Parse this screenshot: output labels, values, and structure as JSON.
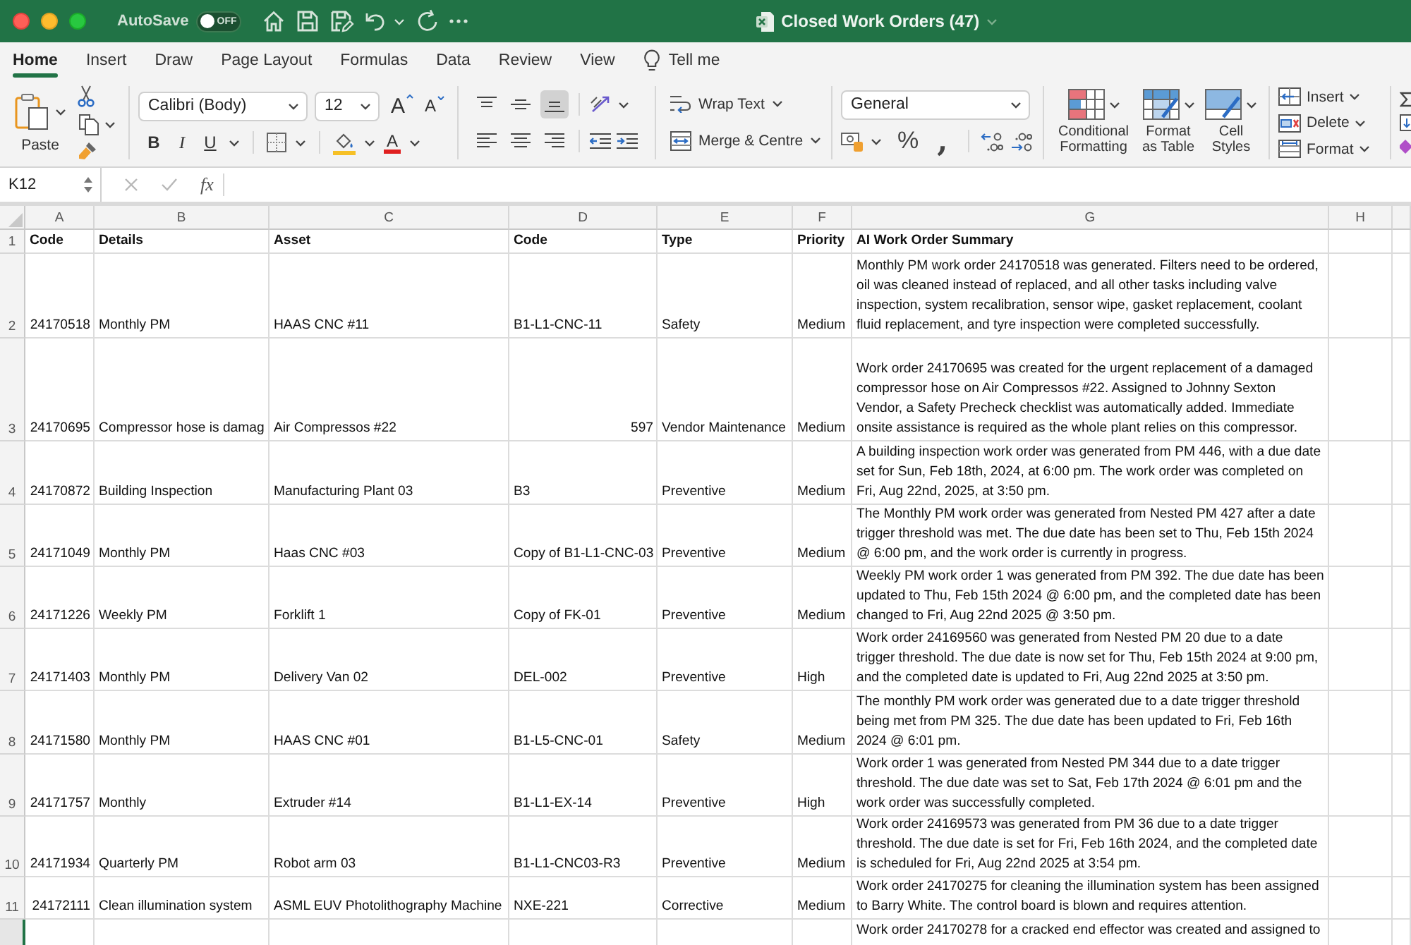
{
  "title_bar": {
    "autosave": {
      "label": "AutoSave",
      "state_text": "OFF",
      "on": false
    },
    "title": "Closed Work Orders (47)"
  },
  "ribbon_tabs": [
    {
      "label": "Home",
      "selected": true
    },
    {
      "label": "Insert",
      "selected": false
    },
    {
      "label": "Draw",
      "selected": false
    },
    {
      "label": "Page Layout",
      "selected": false
    },
    {
      "label": "Formulas",
      "selected": false
    },
    {
      "label": "Data",
      "selected": false
    },
    {
      "label": "Review",
      "selected": false
    },
    {
      "label": "View",
      "selected": false
    }
  ],
  "tell_me": "Tell me",
  "ribbon": {
    "paste": "Paste",
    "font_name": "Calibri (Body)",
    "font_size": "12",
    "grow_font": "A",
    "shrink_font": "A",
    "bold": "B",
    "italic": "I",
    "underline": "U",
    "font_color": "A",
    "vertical_align": [
      {
        "kind": "top",
        "selected": false
      },
      {
        "kind": "middle",
        "selected": false
      },
      {
        "kind": "bottom",
        "selected": true
      }
    ],
    "horizontal_align": [
      {
        "kind": "left",
        "selected": false
      },
      {
        "kind": "center",
        "selected": false
      },
      {
        "kind": "right",
        "selected": false
      }
    ],
    "wrap_text": "Wrap Text",
    "merge_centre": "Merge & Centre",
    "number_format": "General",
    "percent": "%",
    "comma": ",",
    "conditional_formatting": "Conditional Formatting",
    "format_as_table": "Format as Table",
    "cell_styles": "Cell Styles",
    "cells_buttons": [
      {
        "kind": "insert",
        "label": "Insert"
      },
      {
        "kind": "delete",
        "label": "Delete"
      },
      {
        "kind": "format",
        "label": "Format"
      }
    ]
  },
  "formula_bar": {
    "name_box": "K12",
    "function_label": "fx"
  },
  "columns": [
    "A",
    "B",
    "C",
    "D",
    "E",
    "F",
    "G",
    "H"
  ],
  "rows": [
    {
      "number": "1",
      "selected": false,
      "cells": [
        {
          "text": "Code",
          "kind": "heading"
        },
        {
          "text": "Details",
          "kind": "heading"
        },
        {
          "text": "Asset",
          "kind": "heading"
        },
        {
          "text": "Code",
          "kind": "heading"
        },
        {
          "text": "Type",
          "kind": "heading"
        },
        {
          "text": "Priority",
          "kind": "heading"
        },
        {
          "text": "AI Work Order Summary",
          "kind": "heading"
        }
      ]
    },
    {
      "number": "2",
      "selected": false,
      "cells": [
        {
          "text": "24170518",
          "kind": "number"
        },
        {
          "text": "Monthly PM",
          "kind": "text"
        },
        {
          "text": "HAAS CNC #11",
          "kind": "text"
        },
        {
          "text": "B1-L1-CNC-11",
          "kind": "text"
        },
        {
          "text": "Safety",
          "kind": "text"
        },
        {
          "text": "Medium",
          "kind": "text"
        },
        {
          "text": "Monthly PM work order 24170518 was generated. Filters need to be ordered, oil was cleaned instead of replaced, and all other tasks including valve inspection, system recalibration, sensor wipe, gasket replacement, coolant fluid replacement, and tyre inspection were completed successfully.",
          "kind": "text"
        }
      ]
    },
    {
      "number": "3",
      "selected": false,
      "cells": [
        {
          "text": "24170695",
          "kind": "number"
        },
        {
          "text": "Compressor hose is damag",
          "kind": "text"
        },
        {
          "text": "Air Compressos #22",
          "kind": "text"
        },
        {
          "text": "597",
          "kind": "number"
        },
        {
          "text": "Vendor Maintenance",
          "kind": "text"
        },
        {
          "text": "Medium",
          "kind": "text"
        },
        {
          "text": "Work order 24170695 was created for the urgent replacement of a damaged compressor hose on Air Compressos #22. Assigned to Johnny Sexton Vendor, a Safety Precheck checklist was automatically added. Immediate onsite assistance is required as the whole plant relies on this compressor.",
          "kind": "text"
        }
      ]
    },
    {
      "number": "4",
      "selected": false,
      "cells": [
        {
          "text": "24170872",
          "kind": "number"
        },
        {
          "text": "Building Inspection",
          "kind": "text"
        },
        {
          "text": "Manufacturing Plant 03",
          "kind": "text"
        },
        {
          "text": "B3",
          "kind": "text"
        },
        {
          "text": "Preventive",
          "kind": "text"
        },
        {
          "text": "Medium",
          "kind": "text"
        },
        {
          "text": "A building inspection work order was generated from PM 446, with a due date set for Sun, Feb 18th, 2024, at 6:00 pm. The work order was completed on Fri, Aug 22nd, 2025, at 3:50 pm.",
          "kind": "text"
        }
      ]
    },
    {
      "number": "5",
      "selected": false,
      "cells": [
        {
          "text": "24171049",
          "kind": "number"
        },
        {
          "text": "Monthly PM",
          "kind": "text"
        },
        {
          "text": "Haas CNC #03",
          "kind": "text"
        },
        {
          "text": "Copy of B1-L1-CNC-03",
          "kind": "text"
        },
        {
          "text": "Preventive",
          "kind": "text"
        },
        {
          "text": "Medium",
          "kind": "text"
        },
        {
          "text": "The Monthly PM work order was generated from Nested PM 427 after a date trigger threshold was met. The due date has been set to Thu, Feb 15th 2024 @ 6:00 pm, and the work order is currently in progress.",
          "kind": "text"
        }
      ]
    },
    {
      "number": "6",
      "selected": false,
      "cells": [
        {
          "text": "24171226",
          "kind": "number"
        },
        {
          "text": "Weekly PM",
          "kind": "text"
        },
        {
          "text": "Forklift 1",
          "kind": "text"
        },
        {
          "text": "Copy of FK-01",
          "kind": "text"
        },
        {
          "text": "Preventive",
          "kind": "text"
        },
        {
          "text": "Medium",
          "kind": "text"
        },
        {
          "text": "Weekly PM work order 1 was generated from PM 392. The due date has been updated to Thu, Feb 15th 2024 @ 6:00 pm, and the completed date has been changed to Fri, Aug 22nd 2025 @ 3:50 pm.",
          "kind": "text"
        }
      ]
    },
    {
      "number": "7",
      "selected": false,
      "cells": [
        {
          "text": "24171403",
          "kind": "number"
        },
        {
          "text": "Monthly PM",
          "kind": "text"
        },
        {
          "text": "Delivery Van 02",
          "kind": "text"
        },
        {
          "text": "DEL-002",
          "kind": "text"
        },
        {
          "text": "Preventive",
          "kind": "text"
        },
        {
          "text": "High",
          "kind": "text"
        },
        {
          "text": "Work order 24169560 was generated from Nested PM 20 due to a date trigger threshold. The due date is now set for Thu, Feb 15th 2024 at 9:00 pm, and the completed date is updated to Fri, Aug 22nd 2025 at 3:50 pm.",
          "kind": "text"
        }
      ]
    },
    {
      "number": "8",
      "selected": false,
      "cells": [
        {
          "text": "24171580",
          "kind": "number"
        },
        {
          "text": "Monthly PM",
          "kind": "text"
        },
        {
          "text": "HAAS CNC #01",
          "kind": "text"
        },
        {
          "text": "B1-L5-CNC-01",
          "kind": "text"
        },
        {
          "text": "Safety",
          "kind": "text"
        },
        {
          "text": "Medium",
          "kind": "text"
        },
        {
          "text": "The monthly PM work order was generated due to a date trigger threshold being met from PM 325. The due date has been updated to Fri, Feb 16th 2024 @ 6:01 pm.",
          "kind": "text"
        }
      ]
    },
    {
      "number": "9",
      "selected": false,
      "cells": [
        {
          "text": "24171757",
          "kind": "number"
        },
        {
          "text": "Monthly",
          "kind": "text"
        },
        {
          "text": "Extruder #14",
          "kind": "text"
        },
        {
          "text": "B1-L1-EX-14",
          "kind": "text"
        },
        {
          "text": "Preventive",
          "kind": "text"
        },
        {
          "text": "High",
          "kind": "text"
        },
        {
          "text": "Work order 1 was generated from Nested PM 344 due to a date trigger threshold. The due date was set to Sat, Feb 17th 2024 @ 6:01 pm and the work order was successfully completed.",
          "kind": "text"
        }
      ]
    },
    {
      "number": "10",
      "selected": false,
      "cells": [
        {
          "text": "24171934",
          "kind": "number"
        },
        {
          "text": "Quarterly PM",
          "kind": "text"
        },
        {
          "text": "Robot arm 03",
          "kind": "text"
        },
        {
          "text": "B1-L1-CNC03-R3",
          "kind": "text"
        },
        {
          "text": "Preventive",
          "kind": "text"
        },
        {
          "text": "Medium",
          "kind": "text"
        },
        {
          "text": "Work order 24169573 was generated from PM 36 due to a date trigger threshold. The due date is set for Fri, Feb 16th 2024, and the completed date is scheduled for Fri, Aug 22nd 2025 at 3:54 pm.",
          "kind": "text"
        }
      ]
    },
    {
      "number": "11",
      "selected": false,
      "cells": [
        {
          "text": "24172111",
          "kind": "number"
        },
        {
          "text": "Clean illumination system",
          "kind": "text"
        },
        {
          "text": "ASML EUV Photolithography Machine",
          "kind": "text"
        },
        {
          "text": "NXE-221",
          "kind": "text"
        },
        {
          "text": "Corrective",
          "kind": "text"
        },
        {
          "text": "Medium",
          "kind": "text"
        },
        {
          "text": "Work order 24170275 for cleaning the illumination system has been assigned to Barry White. The control board is blown and requires attention.",
          "kind": "text"
        }
      ]
    }
  ],
  "partial_row": {
    "selected": true,
    "summary": "Work order 24170278 for a cracked end effector was created and assigned to"
  }
}
